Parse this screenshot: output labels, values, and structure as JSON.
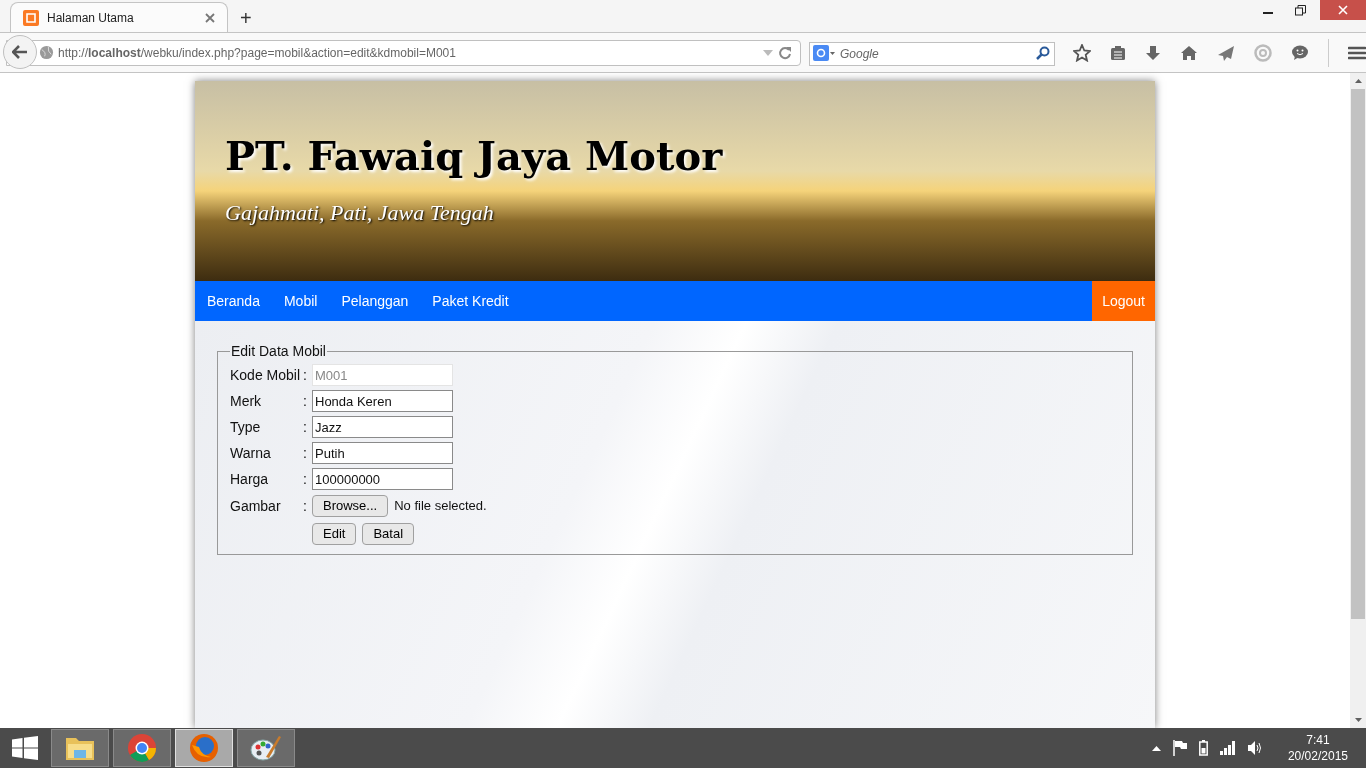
{
  "browser": {
    "tab_title": "Halaman Utama",
    "new_tab": "+",
    "url": "http://**localhost**/webku/index.php?page=mobil&action=edit&kdmobil=M001",
    "search_placeholder": "Google"
  },
  "site": {
    "title": "PT. Fawaiq Jaya Motor",
    "subtitle": "Gajahmati, Pati, Jawa Tengah",
    "nav": [
      {
        "label": "Beranda"
      },
      {
        "label": "Mobil"
      },
      {
        "label": "Pelanggan"
      },
      {
        "label": "Paket Kredit"
      }
    ],
    "logout": "Logout"
  },
  "form": {
    "legend": "Edit Data Mobil",
    "fields": [
      {
        "label": "Kode Mobil",
        "colon": ":",
        "value": "M001",
        "disabled": true
      },
      {
        "label": "Merk",
        "colon": ":",
        "value": "Honda Keren",
        "disabled": false
      },
      {
        "label": "Type",
        "colon": ":",
        "value": "Jazz",
        "disabled": false
      },
      {
        "label": "Warna",
        "colon": ":",
        "value": "Putih",
        "disabled": false
      },
      {
        "label": "Harga",
        "colon": ":",
        "value": "100000000",
        "disabled": false
      }
    ],
    "file": {
      "label": "Gambar",
      "colon": ":",
      "button": "Browse...",
      "status": "No file selected."
    },
    "buttons": [
      "Edit",
      "Batal"
    ]
  },
  "taskbar": {
    "apps": [
      {
        "kind": "folder",
        "selected": false
      },
      {
        "kind": "chrome",
        "selected": false
      },
      {
        "kind": "firefox",
        "selected": true
      },
      {
        "kind": "paint",
        "selected": false
      }
    ],
    "time": "7:41",
    "date": "20/02/2015"
  }
}
